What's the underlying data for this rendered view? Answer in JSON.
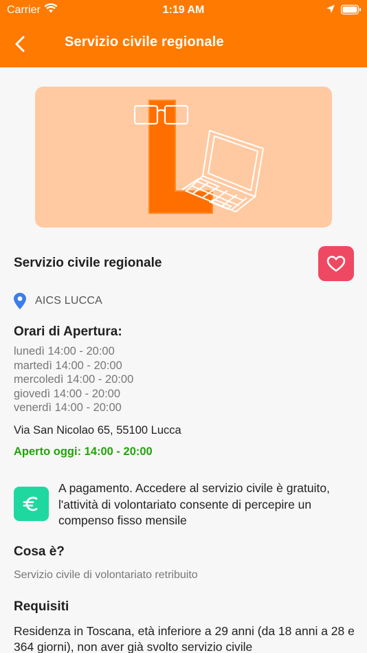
{
  "status_bar": {
    "carrier": "Carrier",
    "time": "1:19 AM"
  },
  "nav": {
    "title": "Servizio civile regionale"
  },
  "hero": {
    "background_color": "#ffc9a1",
    "letter_color": "#ff6f00"
  },
  "service": {
    "title": "Servizio civile regionale",
    "organization": "AICS LUCCA"
  },
  "hours": {
    "title": "Orari di Apertura:",
    "days": [
      "lunedì 14:00 - 20:00",
      "martedì 14:00 - 20:00",
      "mercoledì 14:00 - 20:00",
      "giovedì 14:00 - 20:00",
      "venerdì 14:00 - 20:00"
    ]
  },
  "address": "Via San Nicolao 65, 55100 Lucca",
  "open_today": "Aperto oggi: 14:00 - 20:00",
  "payment": {
    "icon": "euro-icon",
    "text": "A pagamento. Accedere al servizio civile è gratuito, l'attività di volontariato consente di percepire un compenso fisso mensile"
  },
  "what_is": {
    "title": "Cosa è?",
    "text": "Servizio civile di volontariato retribuito"
  },
  "requirements": {
    "title": "Requisiti",
    "text": "Residenza in Toscana, età inferiore a 29 anni (da 18 anni a 28 e 364 giorni), non aver già svolto servizio civile"
  },
  "colors": {
    "accent": "#ff7a00",
    "favorite": "#ef4862",
    "payment_badge": "#1fd8a0",
    "open_status": "#22a30a",
    "location_pin": "#3d7de8"
  }
}
